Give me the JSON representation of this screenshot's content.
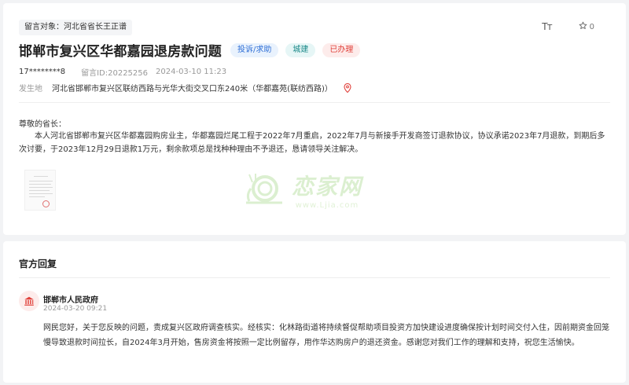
{
  "message": {
    "target_label": "留言对象：",
    "target_value": "河北省省长王正谱",
    "title": "邯郸市复兴区华都嘉园退房款问题",
    "badges": {
      "type": "投诉/求助",
      "area": "城建",
      "status": "已办理"
    },
    "author": "17********8",
    "message_id": "留言ID:20225256",
    "date": "2024-03-10 11:23",
    "location_label": "发生地",
    "location_value": "河北省邯郸市复兴区联纺西路与光华大街交叉口东240米（华都嘉苑(联纺西路)）",
    "greeting": "尊敬的省长：",
    "body": "本人河北省邯郸市复兴区华都嘉园购房业主，华都嘉园烂尾工程于2022年7月重启，2022年7月与新接手开发商签订退款协议，协议承诺2023年7月退款，到期后多次讨要，于2023年12月29日退款1万元，剩余款项总是找种种理由不予退还，恳请领导关注解决。"
  },
  "tools": {
    "font_size_label": "Tт",
    "star_count": "0"
  },
  "watermark": {
    "text": "恋家网",
    "url": "www.Ljia.com"
  },
  "reply": {
    "section_title": "官方回复",
    "gov_name": "邯郸市人民政府",
    "time": "2024-03-20 09:21",
    "text": "网民您好，关于您反映的问题，责成复兴区政府调查核实。经核实：化林路街道将持续督促帮助项目投资方加快建设进度确保按计划时间交付入住，因前期资金回笼慢导致退款时间拉长，自2024年3月开始，售房资金将按照一定比例留存，用作华达购房户的退还资金。感谢您对我们工作的理解和支持，祝您生活愉快。"
  },
  "colors": {
    "accent_blue": "#2f6fd6",
    "status_red": "#e0403a",
    "area_teal": "#1d8a8a"
  }
}
